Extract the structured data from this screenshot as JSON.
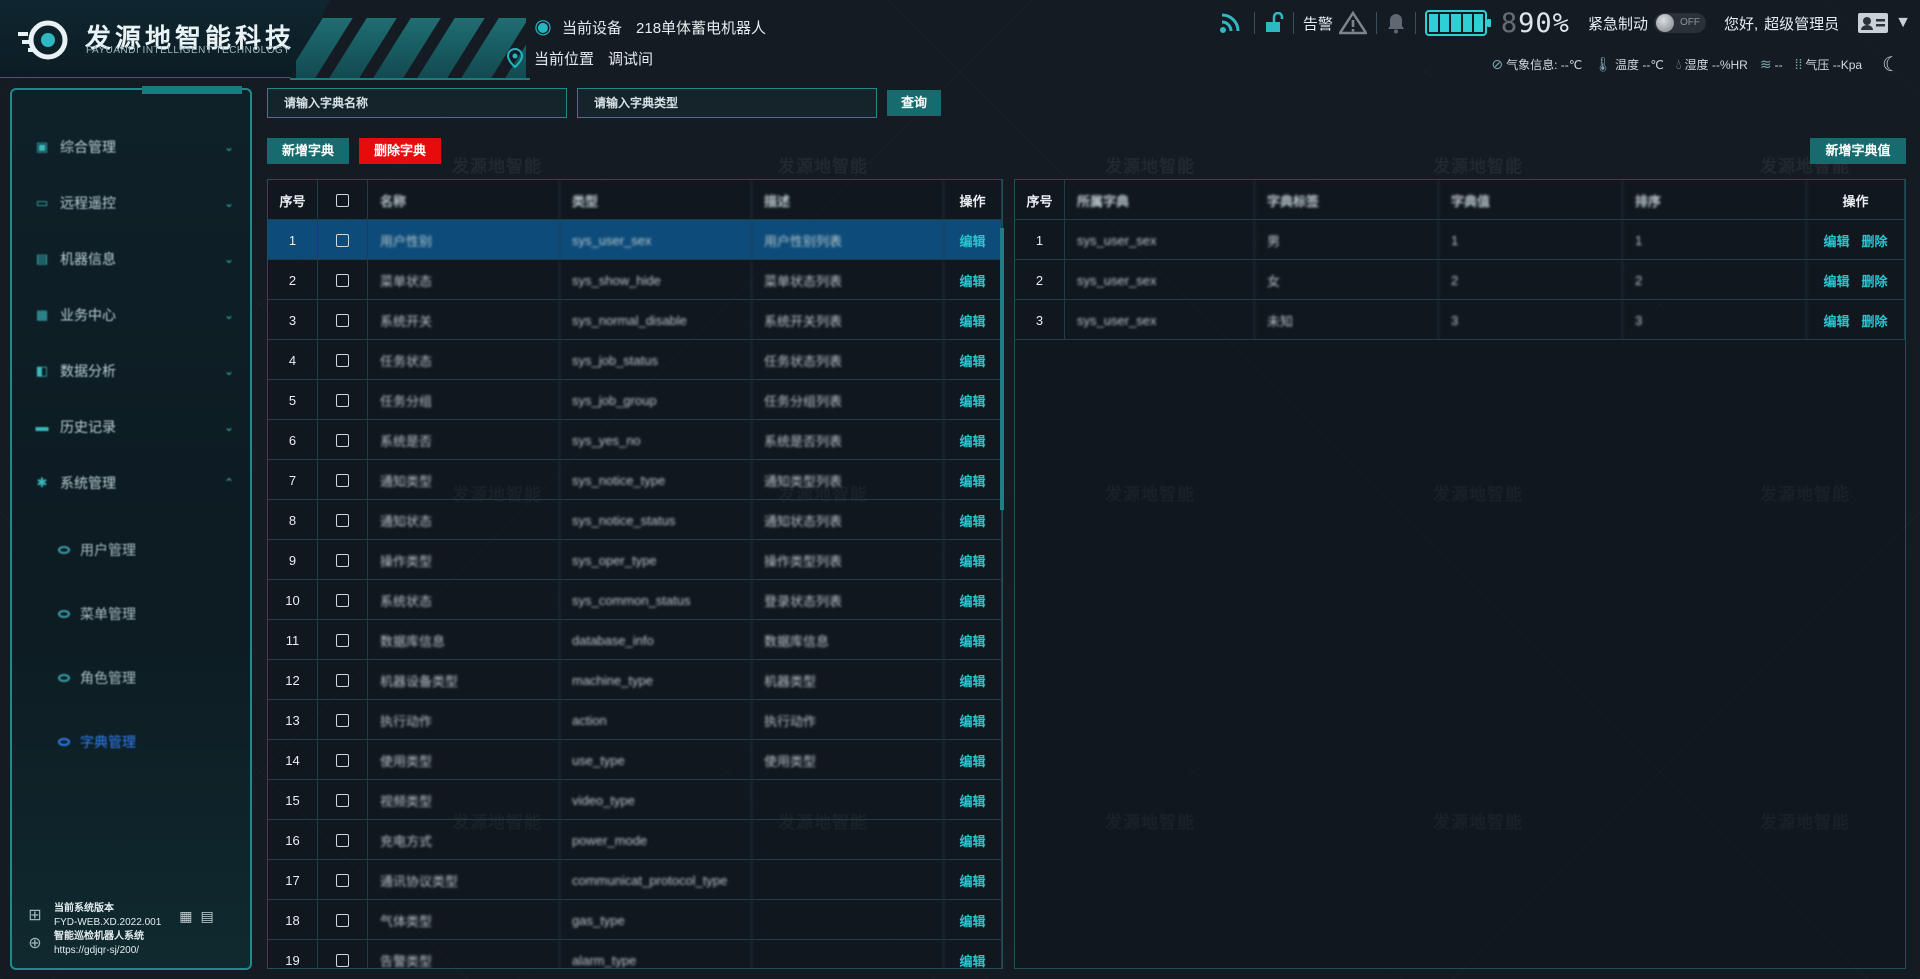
{
  "header": {
    "logo_cn": "发源地智能科技",
    "logo_en": "FAYUANDI INTELLIGENT TECHNOLOGY",
    "device_label": "当前设备",
    "device_value": "218单体蓄电机器人",
    "location_label": "当前位置",
    "location_value": "调试间",
    "alarm_label": "告警",
    "battery_pct": "90%",
    "battery_level": 0.9,
    "emergency_label": "紧急制动",
    "toggle_state": "OFF",
    "greeting": "您好,",
    "username": "超级管理员"
  },
  "weather": {
    "info_label": "气象信息:",
    "info_value": "--℃",
    "temp_label": "温度",
    "temp_value": "--℃",
    "humidity_label": "湿度",
    "humidity_value": "--%HR",
    "wind_value": "--",
    "pressure_label": "气压",
    "pressure_value": "--Kpa"
  },
  "watermark": "发源地智能",
  "sidebar": {
    "items": [
      {
        "label": "综合管理",
        "icon": "robot-icon"
      },
      {
        "label": "远程遥控",
        "icon": "monitor-icon"
      },
      {
        "label": "机器信息",
        "icon": "id-card-icon"
      },
      {
        "label": "业务中心",
        "icon": "building-icon"
      },
      {
        "label": "数据分析",
        "icon": "chart-icon"
      },
      {
        "label": "历史记录",
        "icon": "folder-icon"
      },
      {
        "label": "系统管理",
        "icon": "gear-icon"
      }
    ],
    "subitems": [
      {
        "label": "用户管理"
      },
      {
        "label": "菜单管理"
      },
      {
        "label": "角色管理"
      },
      {
        "label": "字典管理"
      }
    ],
    "version_label": "当前系统版本",
    "version_value": "FYD-WEB.XD.2022.001",
    "system_name": "智能巡检机器人系统",
    "url": "https://gdjqr-sj/200/"
  },
  "toolbar": {
    "dict_name_placeholder": "请输入字典名称",
    "dict_type_placeholder": "请输入字典类型",
    "query_label": "查询",
    "add_dict_label": "新增字典",
    "delete_dict_label": "删除字典",
    "add_value_label": "新增字典值"
  },
  "left_table": {
    "headers": [
      "序号",
      "",
      "名称",
      "类型",
      "描述",
      "操作"
    ],
    "edit_label": "编辑",
    "rows": [
      {
        "no": "1",
        "name": "用户性别",
        "type": "sys_user_sex",
        "desc": "用户性别列表"
      },
      {
        "no": "2",
        "name": "菜单状态",
        "type": "sys_show_hide",
        "desc": "菜单状态列表"
      },
      {
        "no": "3",
        "name": "系统开关",
        "type": "sys_normal_disable",
        "desc": "系统开关列表"
      },
      {
        "no": "4",
        "name": "任务状态",
        "type": "sys_job_status",
        "desc": "任务状态列表"
      },
      {
        "no": "5",
        "name": "任务分组",
        "type": "sys_job_group",
        "desc": "任务分组列表"
      },
      {
        "no": "6",
        "name": "系统是否",
        "type": "sys_yes_no",
        "desc": "系统是否列表"
      },
      {
        "no": "7",
        "name": "通知类型",
        "type": "sys_notice_type",
        "desc": "通知类型列表"
      },
      {
        "no": "8",
        "name": "通知状态",
        "type": "sys_notice_status",
        "desc": "通知状态列表"
      },
      {
        "no": "9",
        "name": "操作类型",
        "type": "sys_oper_type",
        "desc": "操作类型列表"
      },
      {
        "no": "10",
        "name": "系统状态",
        "type": "sys_common_status",
        "desc": "登录状态列表"
      },
      {
        "no": "11",
        "name": "数据库信息",
        "type": "database_info",
        "desc": "数据库信息"
      },
      {
        "no": "12",
        "name": "机器设备类型",
        "type": "machine_type",
        "desc": "机器类型"
      },
      {
        "no": "13",
        "name": "执行动作",
        "type": "action",
        "desc": "执行动作"
      },
      {
        "no": "14",
        "name": "使用类型",
        "type": "use_type",
        "desc": "使用类型"
      },
      {
        "no": "15",
        "name": "视频类型",
        "type": "video_type",
        "desc": ""
      },
      {
        "no": "16",
        "name": "充电方式",
        "type": "power_mode",
        "desc": ""
      },
      {
        "no": "17",
        "name": "通讯协议类型",
        "type": "communicat_protocol_type",
        "desc": ""
      },
      {
        "no": "18",
        "name": "气体类型",
        "type": "gas_type",
        "desc": ""
      },
      {
        "no": "19",
        "name": "告警类型",
        "type": "alarm_type",
        "desc": ""
      }
    ]
  },
  "right_table": {
    "headers": [
      "序号",
      "所属字典",
      "字典标签",
      "字典值",
      "排序",
      "操作"
    ],
    "edit_label": "编辑",
    "delete_label": "删除",
    "rows": [
      {
        "no": "1",
        "dict": "sys_user_sex",
        "label": "男",
        "value": "1",
        "sort": "1"
      },
      {
        "no": "2",
        "dict": "sys_user_sex",
        "label": "女",
        "value": "2",
        "sort": "2"
      },
      {
        "no": "3",
        "dict": "sys_user_sex",
        "label": "未知",
        "value": "3",
        "sort": "3"
      }
    ]
  }
}
